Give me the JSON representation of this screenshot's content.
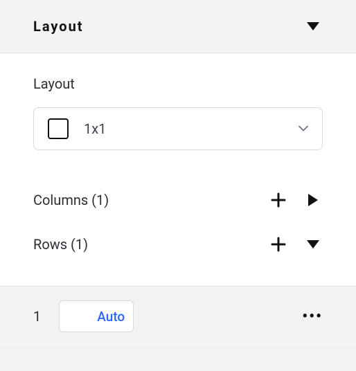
{
  "header": {
    "title": "Layout"
  },
  "section": {
    "label": "Layout",
    "dropdown_value": "1x1"
  },
  "columns": {
    "label": "Columns (1)"
  },
  "rows": {
    "label": "Rows (1)",
    "items": [
      {
        "index": "1",
        "size_mode": "Auto"
      }
    ]
  }
}
